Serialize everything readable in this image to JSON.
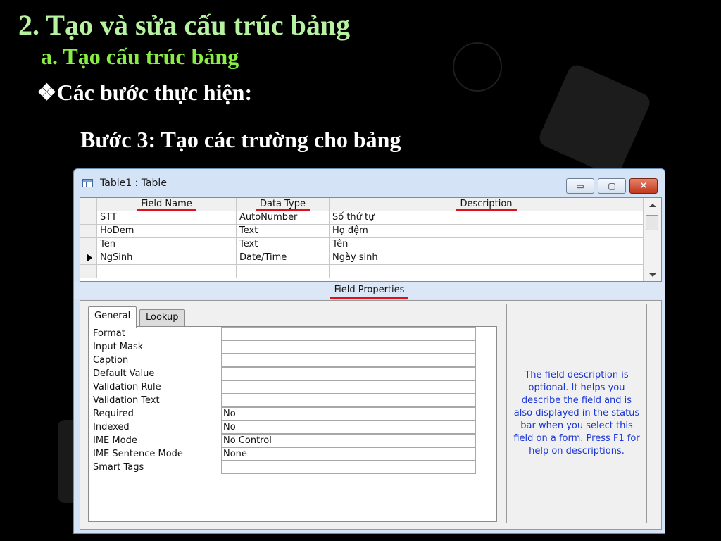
{
  "slide": {
    "title": "2. Tạo và sửa cấu trúc bảng",
    "subtitle": "a. Tạo cấu trúc bảng",
    "bullet_symbol": "❖",
    "bullet": "Các bước thực hiện:",
    "step": "Bước 3: Tạo các trường cho bảng"
  },
  "window": {
    "title": "Table1 : Table",
    "icon": "table-icon",
    "buttons": {
      "minimize": "▭",
      "restore": "▢",
      "close": "✕"
    }
  },
  "grid": {
    "headers": [
      "Field Name",
      "Data Type",
      "Description"
    ],
    "rows": [
      {
        "field": "STT",
        "type": "AutoNumber",
        "desc": "Số thứ tự"
      },
      {
        "field": "HoDem",
        "type": "Text",
        "desc": "Họ đệm"
      },
      {
        "field": "Ten",
        "type": "Text",
        "desc": "Tên"
      },
      {
        "field": "NgSinh",
        "type": "Date/Time",
        "desc": "Ngày sinh"
      }
    ],
    "current_row": 3
  },
  "field_properties": {
    "label": "Field Properties",
    "tabs": [
      "General",
      "Lookup"
    ],
    "active_tab": "General",
    "properties": [
      {
        "label": "Format",
        "value": ""
      },
      {
        "label": "Input Mask",
        "value": ""
      },
      {
        "label": "Caption",
        "value": ""
      },
      {
        "label": "Default Value",
        "value": ""
      },
      {
        "label": "Validation Rule",
        "value": ""
      },
      {
        "label": "Validation Text",
        "value": ""
      },
      {
        "label": "Required",
        "value": "No"
      },
      {
        "label": "Indexed",
        "value": "No"
      },
      {
        "label": "IME Mode",
        "value": "No Control"
      },
      {
        "label": "IME Sentence Mode",
        "value": "None"
      },
      {
        "label": "Smart Tags",
        "value": ""
      }
    ],
    "help_text": "The field description is optional.  It helps you describe the field and is also displayed in the status bar when you select this field on a form.  Press F1 for help on descriptions."
  },
  "colors": {
    "title": "#b6f2a0",
    "subtitle": "#88ee44",
    "underline": "#e0101a",
    "help_text": "#1a35d8"
  }
}
